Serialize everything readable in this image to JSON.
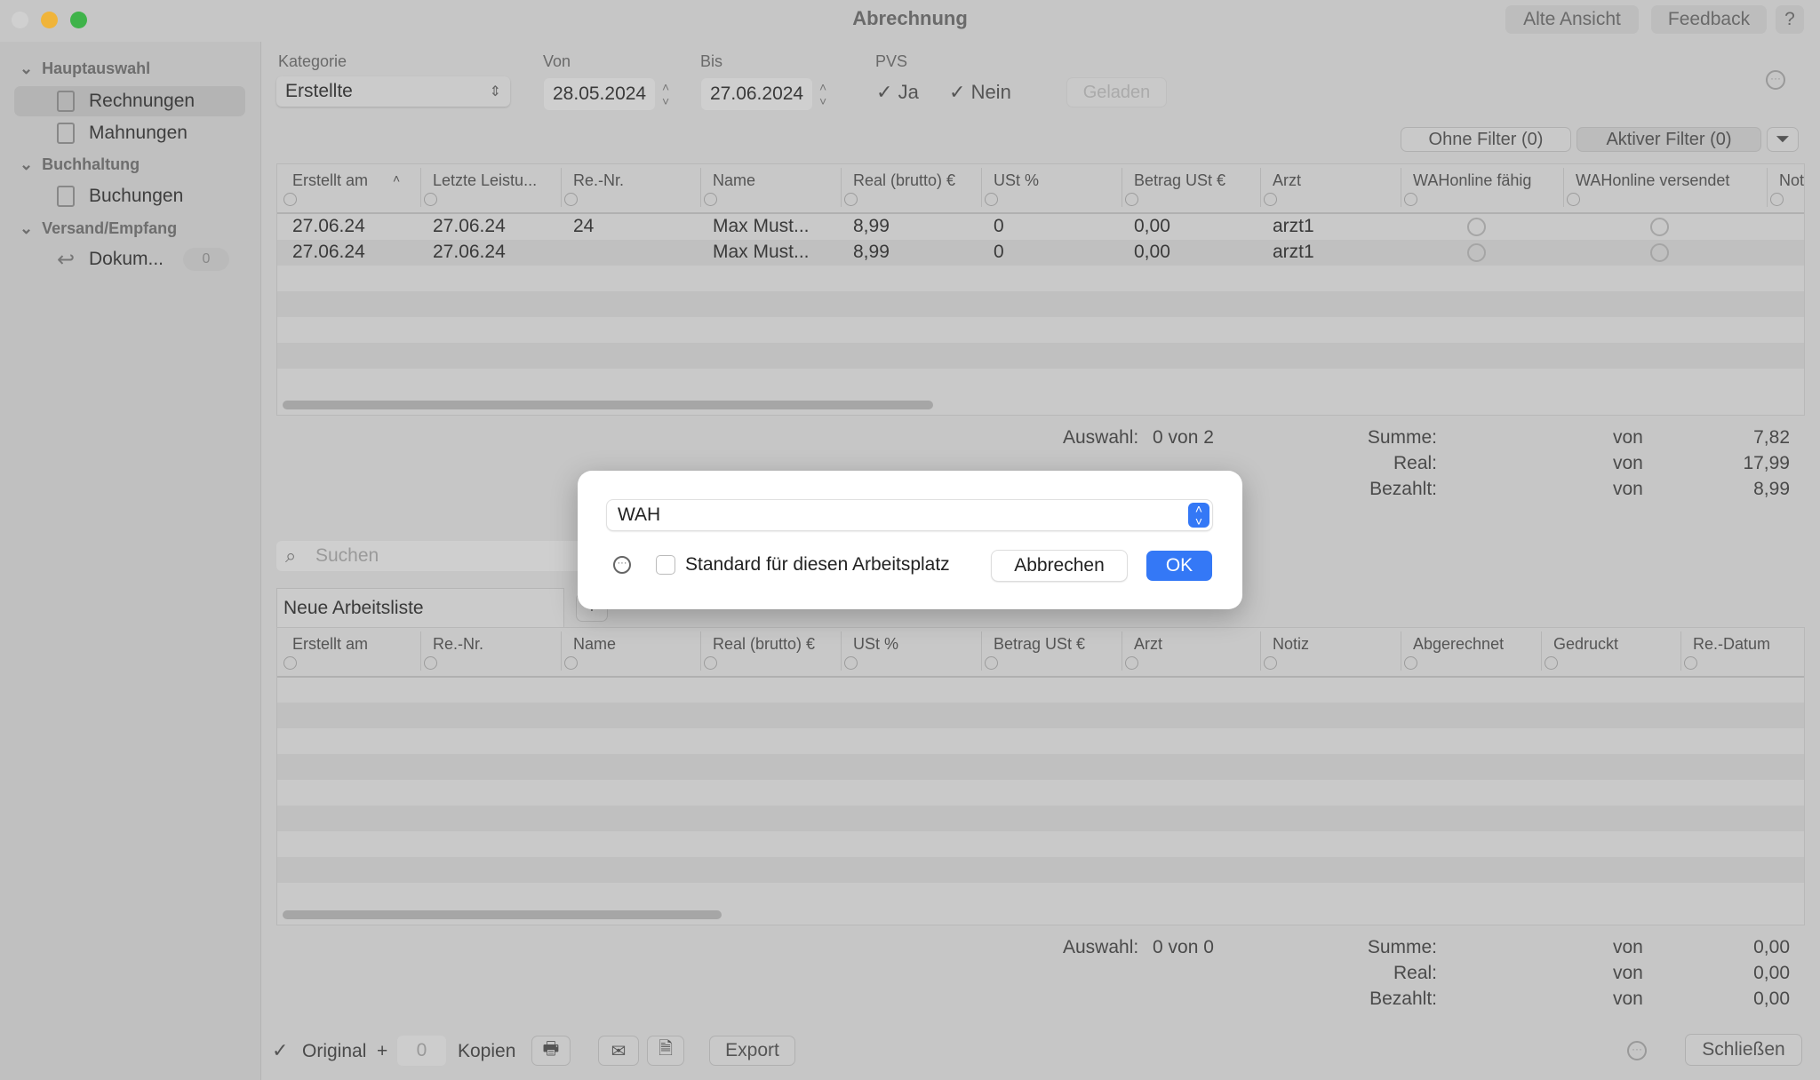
{
  "window": {
    "title": "Abrechnung",
    "old_view": "Alte Ansicht",
    "feedback": "Feedback",
    "help": "?"
  },
  "sidebar": {
    "groups": [
      {
        "label": "Hauptauswahl",
        "items": [
          {
            "label": "Rechnungen",
            "selected": true
          },
          {
            "label": "Mahnungen"
          }
        ]
      },
      {
        "label": "Buchhaltung",
        "items": [
          {
            "label": "Buchungen"
          }
        ]
      },
      {
        "label": "Versand/Empfang",
        "items": [
          {
            "label": "Dokum...",
            "badge": "0"
          }
        ]
      }
    ]
  },
  "filters": {
    "kategorie_label": "Kategorie",
    "kategorie_value": "Erstellte",
    "von_label": "Von",
    "von_value": "28.05.2024",
    "bis_label": "Bis",
    "bis_value": "27.06.2024",
    "pvs_label": "PVS",
    "ja": "Ja",
    "nein": "Nein",
    "ja_checked": true,
    "nein_checked": true,
    "geladen": "Geladen",
    "ohne_filter": "Ohne Filter (0)",
    "aktiver_filter": "Aktiver Filter (0)"
  },
  "table1": {
    "columns": [
      "Erstellt am",
      "Letzte Leistu...",
      "Re.-Nr.",
      "Name",
      "Real (brutto) €",
      "USt %",
      "Betrag USt €",
      "Arzt",
      "WAHonline fähig",
      "WAHonline versendet",
      "Not"
    ],
    "rows": [
      [
        "27.06.24",
        "27.06.24",
        "24",
        "Max Must...",
        "8,99",
        "0",
        "0,00",
        "arzt1"
      ],
      [
        "27.06.24",
        "27.06.24",
        "",
        "Max Must...",
        "8,99",
        "0",
        "0,00",
        "arzt1"
      ]
    ]
  },
  "summary1": {
    "auswahl_label": "Auswahl:",
    "auswahl_value": "0 von 2",
    "summe": "Summe:",
    "real": "Real:",
    "bezahlt": "Bezahlt:",
    "von": "von",
    "summe_value": "7,82",
    "real_value": "17,99",
    "bezahlt_value": "8,99"
  },
  "search": {
    "placeholder": "Suchen"
  },
  "worklist": {
    "tab": "Neue Arbeitsliste",
    "add": "+"
  },
  "table2": {
    "columns": [
      "Erstellt am",
      "Re.-Nr.",
      "Name",
      "Real (brutto) €",
      "USt %",
      "Betrag USt €",
      "Arzt",
      "Notiz",
      "Abgerechnet",
      "Gedruckt",
      "Re.-Datum"
    ]
  },
  "summary2": {
    "auswahl_label": "Auswahl:",
    "auswahl_value": "0 von 0",
    "summe": "Summe:",
    "real": "Real:",
    "bezahlt": "Bezahlt:",
    "von": "von",
    "summe_value": "0,00",
    "real_value": "0,00",
    "bezahlt_value": "0,00"
  },
  "bottom": {
    "original": "Original",
    "plus": "+",
    "copies_value": "0",
    "kopien": "Kopien",
    "export": "Export",
    "close": "Schließen"
  },
  "dialog": {
    "select_value": "WAH",
    "standard_label": "Standard für diesen Arbeitsplatz",
    "cancel": "Abbrechen",
    "ok": "OK",
    "accent": "#3478f6"
  }
}
